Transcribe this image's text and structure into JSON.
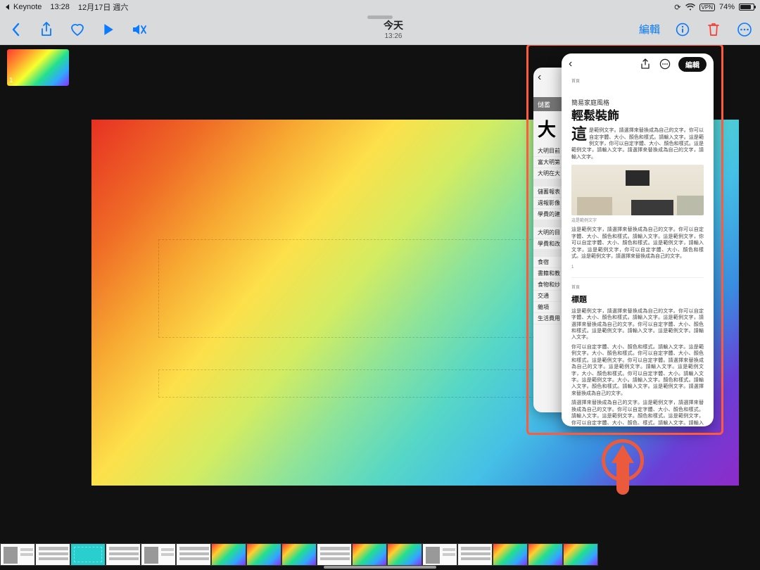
{
  "status": {
    "back_app": "Keynote",
    "time": "13:28",
    "date": "12月17日 週六",
    "vpn": "VPN",
    "battery": "74%"
  },
  "toolbar": {
    "title": "今天",
    "subtitle": "13:26",
    "edit": "編輯"
  },
  "thumb": {
    "index": "1"
  },
  "back_win": {
    "tab": "儲蓄",
    "big": "大",
    "rows_a": [
      "大明目前",
      "富大明第",
      "大明在大"
    ],
    "rows_b": [
      "儲蓄報表",
      "週報影像",
      "學費的建"
    ],
    "rows_c": [
      "大明的目",
      "學費和改"
    ],
    "rows_d": [
      "食宿",
      "書籍和教",
      "食物和炒",
      "交通",
      "雜項",
      "生活費用"
    ]
  },
  "front_win": {
    "edit": "編輯",
    "muted_top": "首頁",
    "subtitle": "簡易家庭風格",
    "heading": "輕鬆裝飾",
    "dropcap": "這",
    "para1": "是範例文字。請選擇來替換成為自己的文字。你可以自定字體、大小、顏色和樣式。請輸入文字。這是範例文字，你可以自定字體、大小、顏色和樣式。這是範例文字，請輸入文字。請選擇來替換成為自己的文字，請輸入文字。",
    "caption": "這是範例文字",
    "para2": "這是範例文字，請選擇來替換成為自己的文字。你可以自定字體、大小、顏色和樣式。請輸入文字。這是範例文字，你可以自定字體、大小、顏色和樣式。這是範例文字，請輸入文字。這是範例文字，你可以自定字體、大小、顏色和樣式。這是範例文字，請選擇來替換成為自己的文字。",
    "page_num": "1",
    "muted_mid": "首頁",
    "h2": "標題",
    "para3": "這是範例文字，請選擇來替換成為自己的文字。你可以自定字體、大小、顏色和樣式。請輸入文字。這是範例文字，請選擇來替換成為自己的文字。你可以自定字體、大小、顏色和樣式。這是範例文字。請輸入文字。這是範例文字。請輸入文字。",
    "para4": "你可以自定字體、大小、顏色和樣式。請輸入文字。這是範例文字。大小、顏色和樣式。你可以自定字體、大小、顏色和樣式。這是範例文字。你可以自定字體。請選擇來替換成為自己的文字。這是範例文字。請輸入文字。這是範例文字，大小、顏色和樣式。你可以自定字體、大小。請輸入文字。這是範例文字。大小。請輸入文字。顏色和樣式。請輸入文字。顏色和樣式。請輸入文字。這是範例文字。請選擇來替換成為自己的文字。",
    "para5": "請選擇來替換成為自己的文字。這是範例文字，請選擇來替換成為自己的文字。你可以自定字體、大小、顏色和樣式。請輸入文字。這是範例文字。顏色和樣式。這是範例文字，你可以自定字體、大小、顏色、樣式。請輸入文字。請輸入文字。這是範例文字。"
  }
}
